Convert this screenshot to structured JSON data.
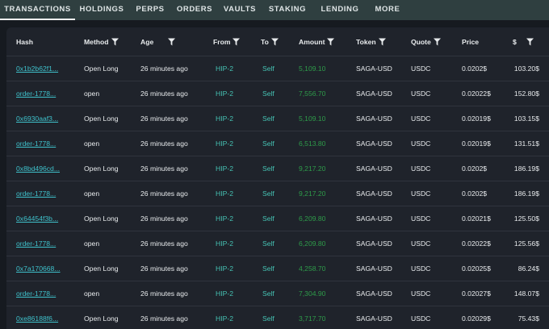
{
  "tabs": [
    "TRANSACTIONS",
    "HOLDINGS",
    "PERPS",
    "ORDERS",
    "VAULTS",
    "STAKING",
    "LENDING",
    "MORE"
  ],
  "columns": [
    "Hash",
    "Method",
    "Age",
    "From",
    "To",
    "Amount",
    "Token",
    "Quote",
    "Price",
    "$"
  ],
  "rows": [
    {
      "hash": "0x1b2b62f1...",
      "method": "Open Long",
      "age": "26 minutes ago",
      "from": "HIP-2",
      "to": "Self",
      "amount": "5,109.10",
      "token": "SAGA-USD",
      "quote": "USDC",
      "price": "0.0202$",
      "usd": "103.20$"
    },
    {
      "hash": "order-1778...",
      "method": "open",
      "age": "26 minutes ago",
      "from": "HIP-2",
      "to": "Self",
      "amount": "7,556.70",
      "token": "SAGA-USD",
      "quote": "USDC",
      "price": "0.02022$",
      "usd": "152.80$"
    },
    {
      "hash": "0x6930aaf3...",
      "method": "Open Long",
      "age": "26 minutes ago",
      "from": "HIP-2",
      "to": "Self",
      "amount": "5,109.10",
      "token": "SAGA-USD",
      "quote": "USDC",
      "price": "0.02019$",
      "usd": "103.15$"
    },
    {
      "hash": "order-1778...",
      "method": "open",
      "age": "26 minutes ago",
      "from": "HIP-2",
      "to": "Self",
      "amount": "6,513.80",
      "token": "SAGA-USD",
      "quote": "USDC",
      "price": "0.02019$",
      "usd": "131.51$"
    },
    {
      "hash": "0x8bd496cd...",
      "method": "Open Long",
      "age": "26 minutes ago",
      "from": "HIP-2",
      "to": "Self",
      "amount": "9,217.20",
      "token": "SAGA-USD",
      "quote": "USDC",
      "price": "0.0202$",
      "usd": "186.19$"
    },
    {
      "hash": "order-1778...",
      "method": "open",
      "age": "26 minutes ago",
      "from": "HIP-2",
      "to": "Self",
      "amount": "9,217.20",
      "token": "SAGA-USD",
      "quote": "USDC",
      "price": "0.0202$",
      "usd": "186.19$"
    },
    {
      "hash": "0x64454f3b...",
      "method": "Open Long",
      "age": "26 minutes ago",
      "from": "HIP-2",
      "to": "Self",
      "amount": "6,209.80",
      "token": "SAGA-USD",
      "quote": "USDC",
      "price": "0.02021$",
      "usd": "125.50$"
    },
    {
      "hash": "order-1778...",
      "method": "open",
      "age": "26 minutes ago",
      "from": "HIP-2",
      "to": "Self",
      "amount": "6,209.80",
      "token": "SAGA-USD",
      "quote": "USDC",
      "price": "0.02022$",
      "usd": "125.56$"
    },
    {
      "hash": "0x7a170668...",
      "method": "Open Long",
      "age": "26 minutes ago",
      "from": "HIP-2",
      "to": "Self",
      "amount": "4,258.70",
      "token": "SAGA-USD",
      "quote": "USDC",
      "price": "0.02025$",
      "usd": "86.24$"
    },
    {
      "hash": "order-1778...",
      "method": "open",
      "age": "26 minutes ago",
      "from": "HIP-2",
      "to": "Self",
      "amount": "7,304.90",
      "token": "SAGA-USD",
      "quote": "USDC",
      "price": "0.02027$",
      "usd": "148.07$"
    },
    {
      "hash": "0xe86188f6...",
      "method": "Open Long",
      "age": "26 minutes ago",
      "from": "HIP-2",
      "to": "Self",
      "amount": "3,717.70",
      "token": "SAGA-USD",
      "quote": "USDC",
      "price": "0.02029$",
      "usd": "75.43$"
    }
  ],
  "icons": {
    "filter": "filter-funnel-icon"
  },
  "colors": {
    "link": "#3fc2cc",
    "from": "#46c3b4",
    "amount": "#2e9c4a",
    "active_tab_underline": "#f2f5f5"
  }
}
